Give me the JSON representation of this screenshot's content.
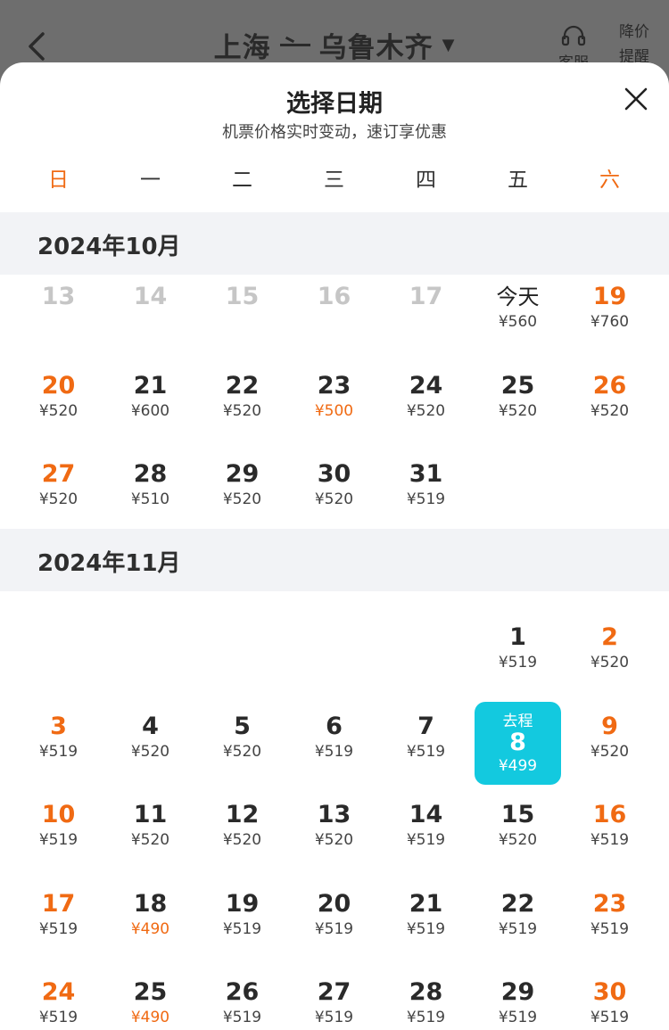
{
  "header": {
    "origin": "上海",
    "destination": "乌鲁木齐",
    "service_label": "客服",
    "alert_label": "降价",
    "alert_label2": "提醒"
  },
  "sheet": {
    "title": "选择日期",
    "subtitle": "机票价格实时变动，速订享优惠"
  },
  "weekdays": [
    "日",
    "一",
    "二",
    "三",
    "四",
    "五",
    "六"
  ],
  "months": [
    {
      "title": "2024年10月",
      "days": [
        {
          "col": 0,
          "row": 0,
          "date": "13",
          "price": "",
          "state": "past"
        },
        {
          "col": 1,
          "row": 0,
          "date": "14",
          "price": "",
          "state": "past"
        },
        {
          "col": 2,
          "row": 0,
          "date": "15",
          "price": "",
          "state": "past"
        },
        {
          "col": 3,
          "row": 0,
          "date": "16",
          "price": "",
          "state": "past"
        },
        {
          "col": 4,
          "row": 0,
          "date": "17",
          "price": "",
          "state": "past"
        },
        {
          "col": 5,
          "row": 0,
          "date": "今天",
          "price": "¥560",
          "state": "today"
        },
        {
          "col": 6,
          "row": 0,
          "date": "19",
          "price": "¥760"
        },
        {
          "col": 0,
          "row": 1,
          "date": "20",
          "price": "¥520"
        },
        {
          "col": 1,
          "row": 1,
          "date": "21",
          "price": "¥600"
        },
        {
          "col": 2,
          "row": 1,
          "date": "22",
          "price": "¥520"
        },
        {
          "col": 3,
          "row": 1,
          "date": "23",
          "price": "¥500",
          "low": true
        },
        {
          "col": 4,
          "row": 1,
          "date": "24",
          "price": "¥520"
        },
        {
          "col": 5,
          "row": 1,
          "date": "25",
          "price": "¥520"
        },
        {
          "col": 6,
          "row": 1,
          "date": "26",
          "price": "¥520"
        },
        {
          "col": 0,
          "row": 2,
          "date": "27",
          "price": "¥520"
        },
        {
          "col": 1,
          "row": 2,
          "date": "28",
          "price": "¥510"
        },
        {
          "col": 2,
          "row": 2,
          "date": "29",
          "price": "¥520"
        },
        {
          "col": 3,
          "row": 2,
          "date": "30",
          "price": "¥520"
        },
        {
          "col": 4,
          "row": 2,
          "date": "31",
          "price": "¥519"
        }
      ]
    },
    {
      "title": "2024年11月",
      "days": [
        {
          "col": 5,
          "row": 0,
          "date": "1",
          "price": "¥519"
        },
        {
          "col": 6,
          "row": 0,
          "date": "2",
          "price": "¥520"
        },
        {
          "col": 0,
          "row": 1,
          "date": "3",
          "price": "¥519"
        },
        {
          "col": 1,
          "row": 1,
          "date": "4",
          "price": "¥520"
        },
        {
          "col": 2,
          "row": 1,
          "date": "5",
          "price": "¥520"
        },
        {
          "col": 3,
          "row": 1,
          "date": "6",
          "price": "¥519"
        },
        {
          "col": 4,
          "row": 1,
          "date": "7",
          "price": "¥519"
        },
        {
          "col": 5,
          "row": 1,
          "date": "8",
          "price": "¥499",
          "state": "selected",
          "tag": "去程"
        },
        {
          "col": 6,
          "row": 1,
          "date": "9",
          "price": "¥520"
        },
        {
          "col": 0,
          "row": 2,
          "date": "10",
          "price": "¥519"
        },
        {
          "col": 1,
          "row": 2,
          "date": "11",
          "price": "¥520"
        },
        {
          "col": 2,
          "row": 2,
          "date": "12",
          "price": "¥520"
        },
        {
          "col": 3,
          "row": 2,
          "date": "13",
          "price": "¥520"
        },
        {
          "col": 4,
          "row": 2,
          "date": "14",
          "price": "¥519"
        },
        {
          "col": 5,
          "row": 2,
          "date": "15",
          "price": "¥520"
        },
        {
          "col": 6,
          "row": 2,
          "date": "16",
          "price": "¥519"
        },
        {
          "col": 0,
          "row": 3,
          "date": "17",
          "price": "¥519"
        },
        {
          "col": 1,
          "row": 3,
          "date": "18",
          "price": "¥490",
          "low": true
        },
        {
          "col": 2,
          "row": 3,
          "date": "19",
          "price": "¥519"
        },
        {
          "col": 3,
          "row": 3,
          "date": "20",
          "price": "¥519"
        },
        {
          "col": 4,
          "row": 3,
          "date": "21",
          "price": "¥519"
        },
        {
          "col": 5,
          "row": 3,
          "date": "22",
          "price": "¥519"
        },
        {
          "col": 6,
          "row": 3,
          "date": "23",
          "price": "¥519"
        },
        {
          "col": 0,
          "row": 4,
          "date": "24",
          "price": "¥519"
        },
        {
          "col": 1,
          "row": 4,
          "date": "25",
          "price": "¥490",
          "low": true
        },
        {
          "col": 2,
          "row": 4,
          "date": "26",
          "price": "¥519"
        },
        {
          "col": 3,
          "row": 4,
          "date": "27",
          "price": "¥519"
        },
        {
          "col": 4,
          "row": 4,
          "date": "28",
          "price": "¥519"
        },
        {
          "col": 5,
          "row": 4,
          "date": "29",
          "price": "¥519"
        },
        {
          "col": 6,
          "row": 4,
          "date": "30",
          "price": "¥519"
        }
      ]
    }
  ],
  "colors": {
    "accent_orange": "#f06a13",
    "selected_teal": "#13c9df",
    "backdrop": "#6e6e6e",
    "month_band": "#f2f3f6"
  }
}
